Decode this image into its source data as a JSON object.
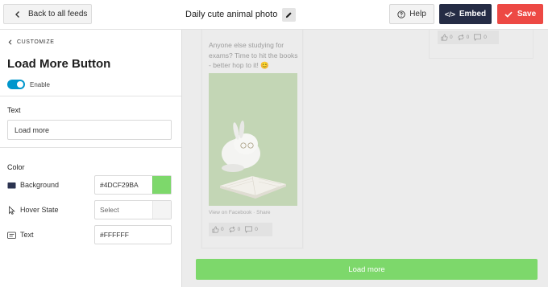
{
  "topbar": {
    "back_label": "Back to all feeds",
    "feed_title": "Daily cute animal photo",
    "help_label": "Help",
    "embed_icon": "</>",
    "embed_label": "Embed",
    "save_label": "Save"
  },
  "sidebar": {
    "breadcrumb": "CUSTOMIZE",
    "section_title": "Load More Button",
    "enable_label": "Enable",
    "enable_on": true,
    "text_heading": "Text",
    "text_value": "Load more",
    "color_heading": "Color",
    "colors": [
      {
        "label": "Background",
        "icon": "background-swatch-icon",
        "value": "#4DCF29BA",
        "swatch": "#7dd86b"
      },
      {
        "label": "Hover State",
        "icon": "cursor-icon",
        "placeholder": "Select"
      },
      {
        "label": "Text",
        "icon": "text-icon",
        "value": "#FFFFFF"
      }
    ]
  },
  "preview": {
    "post_text": "Anyone else studying for exams? Time to hit the books - better hop to it! 😊",
    "fb_link": "View on Facebook",
    "share_link": "Share",
    "separator": "·",
    "likes": "0",
    "shares": "0",
    "comments": "0",
    "card2_likes": "0",
    "card2_shares": "0",
    "card2_comments": "0",
    "load_more_label": "Load more",
    "accent": "#7dd86b"
  }
}
